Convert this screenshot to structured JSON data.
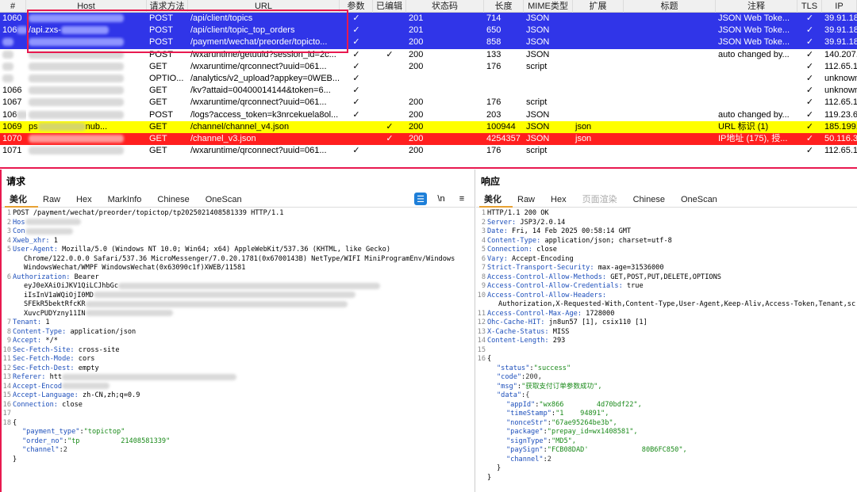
{
  "table": {
    "columns": [
      "#",
      "Host",
      "请求方法",
      "URL",
      "参数",
      "已编辑",
      "状态码",
      "长度",
      "MIME类型",
      "扩展",
      "标题",
      "注释",
      "TLS",
      "IP"
    ],
    "rows": [
      {
        "id": "1060",
        "method": "POST",
        "url": "/api/client/topics",
        "params": "✓",
        "edited": "",
        "status": "201",
        "length": "714",
        "mime": "JSON",
        "ext": "",
        "title": "",
        "comment": "JSON Web Toke...",
        "tls": "✓",
        "ip": "39.91.182.35",
        "color": "blue",
        "host": ""
      },
      {
        "id": "106",
        "method": "POST",
        "url": "/api/client/topic_top_orders",
        "params": "✓",
        "edited": "",
        "status": "201",
        "length": "650",
        "mime": "JSON",
        "ext": "",
        "title": "",
        "comment": "JSON Web Toke...",
        "tls": "✓",
        "ip": "39.91.182.35",
        "color": "blue",
        "host": "/api.zxs-"
      },
      {
        "id": "",
        "method": "POST",
        "url": "/payment/wechat/preorder/topicto...",
        "params": "✓",
        "edited": "",
        "status": "200",
        "length": "858",
        "mime": "JSON",
        "ext": "",
        "title": "",
        "comment": "JSON Web Toke...",
        "tls": "✓",
        "ip": "39.91.182.35",
        "color": "blue",
        "host": ""
      },
      {
        "id": "",
        "method": "POST",
        "url": "/wxaruntime/getuuid?session_id=2c...",
        "params": "✓",
        "edited": "✓",
        "status": "200",
        "length": "133",
        "mime": "JSON",
        "ext": "",
        "title": "",
        "comment": "auto changed by...",
        "tls": "✓",
        "ip": "140.207.176.2",
        "color": "white",
        "host": ""
      },
      {
        "id": "",
        "method": "GET",
        "url": "/wxaruntime/qrconnect?uuid=061...",
        "params": "✓",
        "edited": "",
        "status": "200",
        "length": "176",
        "mime": "script",
        "ext": "",
        "title": "",
        "comment": "",
        "tls": "✓",
        "ip": "112.65.193.15",
        "color": "white",
        "host": ""
      },
      {
        "id": "",
        "method": "OPTIO...",
        "url": "/analytics/v2_upload?appkey=0WEB...",
        "params": "✓",
        "edited": "",
        "status": "",
        "length": "",
        "mime": "",
        "ext": "",
        "title": "",
        "comment": "",
        "tls": "✓",
        "ip": "unknown hos",
        "color": "white",
        "host": ""
      },
      {
        "id": "1066",
        "method": "GET",
        "url": "/kv?attaid=00400014144&token=6...",
        "params": "✓",
        "edited": "",
        "status": "",
        "length": "",
        "mime": "",
        "ext": "",
        "title": "",
        "comment": "",
        "tls": "✓",
        "ip": "unknown hos",
        "color": "white",
        "host": ""
      },
      {
        "id": "1067",
        "method": "GET",
        "url": "/wxaruntime/qrconnect?uuid=061...",
        "params": "✓",
        "edited": "",
        "status": "200",
        "length": "176",
        "mime": "script",
        "ext": "",
        "title": "",
        "comment": "",
        "tls": "✓",
        "ip": "112.65.193.15",
        "color": "white",
        "host": ""
      },
      {
        "id": "106",
        "method": "POST",
        "url": "/logs?access_token=k3nrcekuela8ol...",
        "params": "✓",
        "edited": "",
        "status": "200",
        "length": "203",
        "mime": "JSON",
        "ext": "",
        "title": "",
        "comment": "auto changed by...",
        "tls": "✓",
        "ip": "119.23.60.8",
        "color": "white",
        "host": ""
      },
      {
        "id": "1069",
        "method": "GET",
        "url": "/channel/channel_v4.json",
        "params": "",
        "edited": "✓",
        "status": "200",
        "length": "100944",
        "mime": "JSON",
        "ext": "json",
        "title": "",
        "comment": "URL 标识 (1)",
        "tls": "✓",
        "ip": "185.199.110.",
        "color": "yellow",
        "host": "ps",
        "host2": "nub..."
      },
      {
        "id": "1070",
        "method": "GET",
        "url": "/channel_v3.json",
        "params": "",
        "edited": "✓",
        "status": "200",
        "length": "4254357",
        "mime": "JSON",
        "ext": "json",
        "title": "",
        "comment": "IP地址 (175), 授...",
        "tls": "✓",
        "ip": "50.116.34.24",
        "color": "red",
        "host": ""
      },
      {
        "id": "1071",
        "method": "GET",
        "url": "/wxaruntime/qrconnect?uuid=061...",
        "params": "✓",
        "edited": "",
        "status": "200",
        "length": "176",
        "mime": "script",
        "ext": "",
        "title": "",
        "comment": "",
        "tls": "✓",
        "ip": "112.65.193.15",
        "color": "white",
        "host": ""
      }
    ]
  },
  "request": {
    "title": "请求",
    "tabs": [
      "美化",
      "Raw",
      "Hex",
      "MarkInfo",
      "Chinese",
      "OneScan"
    ],
    "active_tab": "美化",
    "tool_newline": "\\n",
    "tool_menu": "≡",
    "lines": [
      {
        "n": "1",
        "k": "",
        "v": "POST /payment/wechat/preorder/topictop/tp2025021408581339 HTTP/1.1"
      },
      {
        "n": "2",
        "k": "Hos",
        "v": ""
      },
      {
        "n": "3",
        "k": "Con",
        "v": ""
      },
      {
        "n": "4",
        "k": "Xweb_xhr:",
        "v": " 1"
      },
      {
        "n": "5",
        "k": "User-Agent:",
        "v": " Mozilla/5.0 (Windows NT 10.0; Win64; x64) AppleWebKit/537.36 (KHTML, like Gecko)"
      },
      {
        "n": "",
        "k": "",
        "v": "Chrome/122.0.0.0 Safari/537.36 MicroMessenger/7.0.20.1781(0x6700143B) NetType/WIFI MiniProgramEnv/Windows"
      },
      {
        "n": "",
        "k": "",
        "v": "WindowsWechat/WMPF WindowsWechat(0x63090c1f)XWEB/11581"
      },
      {
        "n": "6",
        "k": "Authorization:",
        "v": " Bearer"
      },
      {
        "n": "",
        "k": "",
        "v": "eyJ0eXAiOiJKV1QiLCJhbGc"
      },
      {
        "n": "",
        "k": "",
        "v": "iIsInV1aWQiOjI0MD"
      },
      {
        "n": "",
        "k": "",
        "v": "SFEkR5bektRfcKR"
      },
      {
        "n": "",
        "k": "",
        "v": "XuvcPUDYzny11IN"
      },
      {
        "n": "7",
        "k": "Tenant:",
        "v": " 1"
      },
      {
        "n": "8",
        "k": "Content-Type:",
        "v": " application/json"
      },
      {
        "n": "9",
        "k": "Accept:",
        "v": " */*"
      },
      {
        "n": "10",
        "k": "Sec-Fetch-Site:",
        "v": " cross-site"
      },
      {
        "n": "11",
        "k": "Sec-Fetch-Mode:",
        "v": " cors"
      },
      {
        "n": "12",
        "k": "Sec-Fetch-Dest:",
        "v": " empty"
      },
      {
        "n": "13",
        "k": "Referer:",
        "v": " htt"
      },
      {
        "n": "14",
        "k": "Accept-Encod",
        "v": ""
      },
      {
        "n": "15",
        "k": "Accept-Language:",
        "v": " zh-CN,zh;q=0.9"
      },
      {
        "n": "16",
        "k": "Connection:",
        "v": " close"
      },
      {
        "n": "17",
        "k": "",
        "v": ""
      },
      {
        "n": "18",
        "k": "",
        "v": "{"
      }
    ],
    "json": [
      {
        "k": "\"payment_type\"",
        "v": "\"topictop\"",
        "t": "s"
      },
      {
        "k": "\"order_no\"",
        "v": "\"tp          21408581339\"",
        "t": "s"
      },
      {
        "k": "\"channel\"",
        "v": "2",
        "t": "n"
      }
    ],
    "close": "}"
  },
  "response": {
    "title": "响应",
    "tabs": [
      "美化",
      "Raw",
      "Hex",
      "页面渲染",
      "Chinese",
      "OneScan"
    ],
    "active_tab": "美化",
    "disabled_tab": "页面渲染",
    "lines": [
      {
        "n": "1",
        "k": "",
        "v": "HTTP/1.1 200 OK"
      },
      {
        "n": "2",
        "k": "Server:",
        "v": " JSP3/2.0.14"
      },
      {
        "n": "3",
        "k": "Date:",
        "v": " Fri, 14 Feb 2025 00:58:14 GMT"
      },
      {
        "n": "4",
        "k": "Content-Type:",
        "v": " application/json; charset=utf-8"
      },
      {
        "n": "5",
        "k": "Connection:",
        "v": " close"
      },
      {
        "n": "6",
        "k": "Vary:",
        "v": " Accept-Encoding"
      },
      {
        "n": "7",
        "k": "Strict-Transport-Security:",
        "v": " max-age=31536000"
      },
      {
        "n": "8",
        "k": "Access-Control-Allow-Methods:",
        "v": " GET,POST,PUT,DELETE,OPTIONS"
      },
      {
        "n": "9",
        "k": "Access-Control-Allow-Credentials:",
        "v": " true"
      },
      {
        "n": "10",
        "k": "Access-Control-Allow-Headers:",
        "v": ""
      },
      {
        "n": "",
        "k": "",
        "v": "Authorization,X-Requested-With,Content-Type,User-Agent,Keep-Aliv,Access-Token,Tenant,sc"
      },
      {
        "n": "11",
        "k": "Access-Control-Max-Age:",
        "v": " 1728000"
      },
      {
        "n": "12",
        "k": "Ohc-Cache-HIT:",
        "v": " jn8un57 [1], csix110 [1]"
      },
      {
        "n": "13",
        "k": "X-Cache-Status:",
        "v": " MISS"
      },
      {
        "n": "14",
        "k": "Content-Length:",
        "v": " 293"
      },
      {
        "n": "15",
        "k": "",
        "v": ""
      },
      {
        "n": "16",
        "k": "",
        "v": "{"
      }
    ],
    "json": [
      {
        "k": "\"status\"",
        "v": "\"success\"",
        "t": "s",
        "indent": 1
      },
      {
        "k": "\"code\"",
        "v": "200,",
        "t": "n",
        "indent": 1
      },
      {
        "k": "\"msg\"",
        "v": "\"获取支付订单参数成功\",",
        "t": "s",
        "indent": 1
      },
      {
        "k": "\"data\"",
        "v": "{",
        "t": "n",
        "indent": 1
      },
      {
        "k": "\"appId\"",
        "v": "\"wx866        4d70bdf22\",",
        "t": "s",
        "indent": 2
      },
      {
        "k": "\"timeStamp\"",
        "v": "\"1    94891\",",
        "t": "s",
        "indent": 2
      },
      {
        "k": "\"nonceStr\"",
        "v": "\"67ae95264be3b\",",
        "t": "s",
        "indent": 2
      },
      {
        "k": "\"package\"",
        "v": "\"prepay_id=wx1408581\",",
        "t": "s",
        "indent": 2
      },
      {
        "k": "\"signType\"",
        "v": "\"MD5\",",
        "t": "s",
        "indent": 2
      },
      {
        "k": "\"paySign\"",
        "v": "\"FCB08DAD'             80B6FC850\",",
        "t": "s",
        "indent": 2
      },
      {
        "k": "\"channel\"",
        "v": "2",
        "t": "n",
        "indent": 2
      }
    ],
    "close_inner": "}",
    "close": "}"
  }
}
